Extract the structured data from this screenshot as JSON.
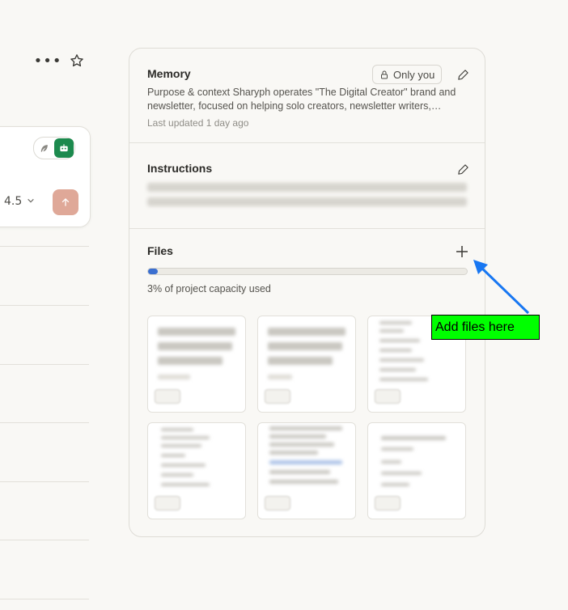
{
  "header": {
    "more_icon": "more-horizontal-icon",
    "star_icon": "star-icon"
  },
  "composer": {
    "model_label": "4.5",
    "send_icon": "arrow-up-icon"
  },
  "memory": {
    "title": "Memory",
    "visibility_badge": "Only you",
    "text_line1": "Purpose & context Sharyph operates \"The Digital Creator\" brand and",
    "text_line2": "newsletter, focused on helping solo creators, newsletter writers,…",
    "last_updated": "Last updated 1 day ago"
  },
  "instructions": {
    "title": "Instructions"
  },
  "files": {
    "title": "Files",
    "capacity_percent": 3,
    "capacity_text": "3% of project capacity used"
  },
  "annotation": {
    "label": "Add files here",
    "color": "#00ff00",
    "arrow_color": "#1877f2"
  }
}
